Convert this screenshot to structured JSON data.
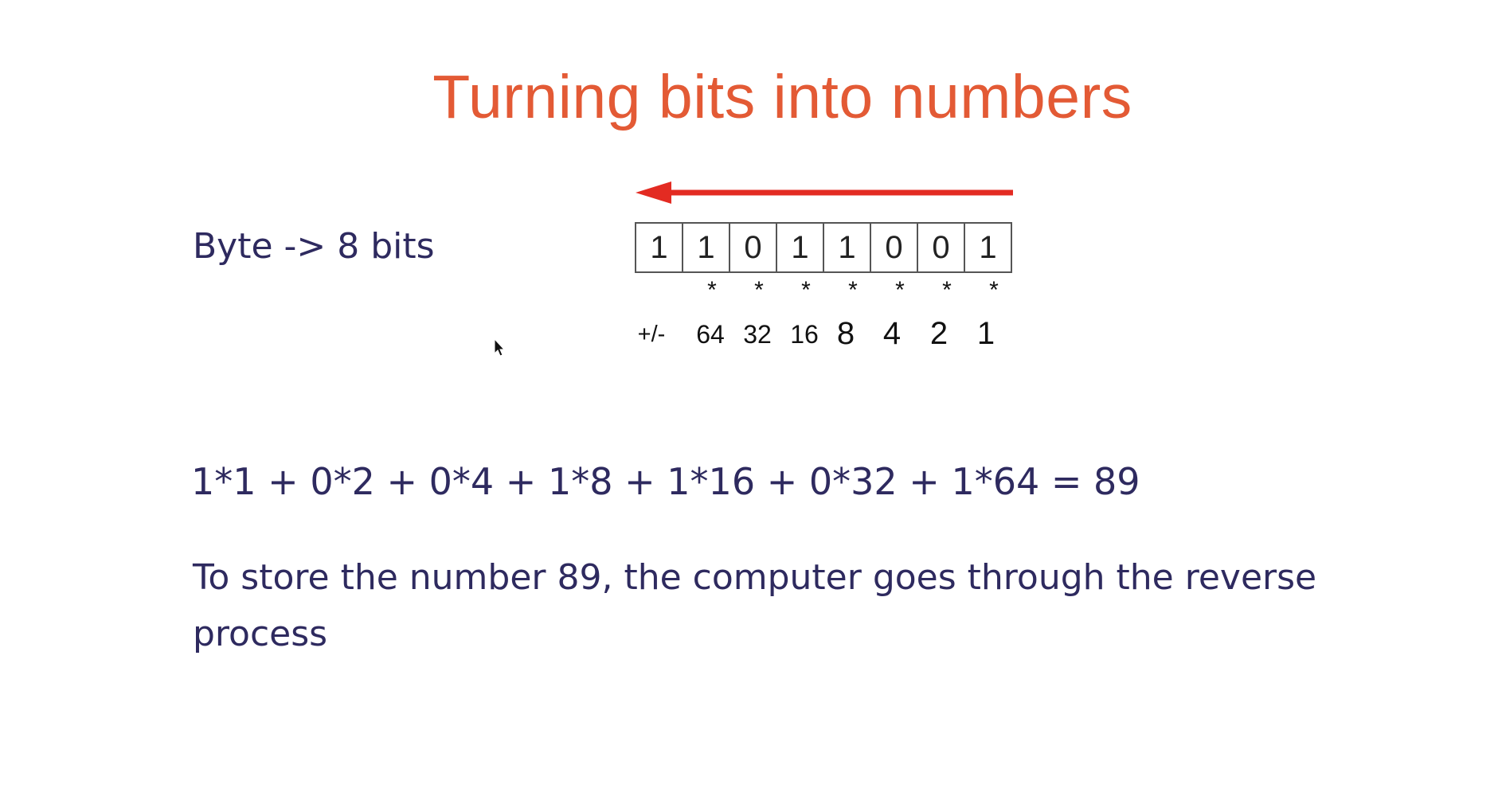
{
  "slide": {
    "title": "Turning bits into numbers",
    "byte_label": "Byte -> 8 bits",
    "bits": [
      "1",
      "1",
      "0",
      "1",
      "1",
      "0",
      "0",
      "1"
    ],
    "multiply_symbol": "*",
    "sign_label": "+/-",
    "weights": [
      "64",
      "32",
      "16",
      "8",
      "4",
      "2",
      "1"
    ],
    "formula": "1*1 + 0*2 + 0*4 + 1*8 + 1*16 + 0*32 + 1*64 = 89",
    "note": "To store the number 89, the computer goes through the reverse process",
    "arrow_color": "#e32b22",
    "title_color": "#e35a35",
    "text_color": "#2e2a5f"
  }
}
